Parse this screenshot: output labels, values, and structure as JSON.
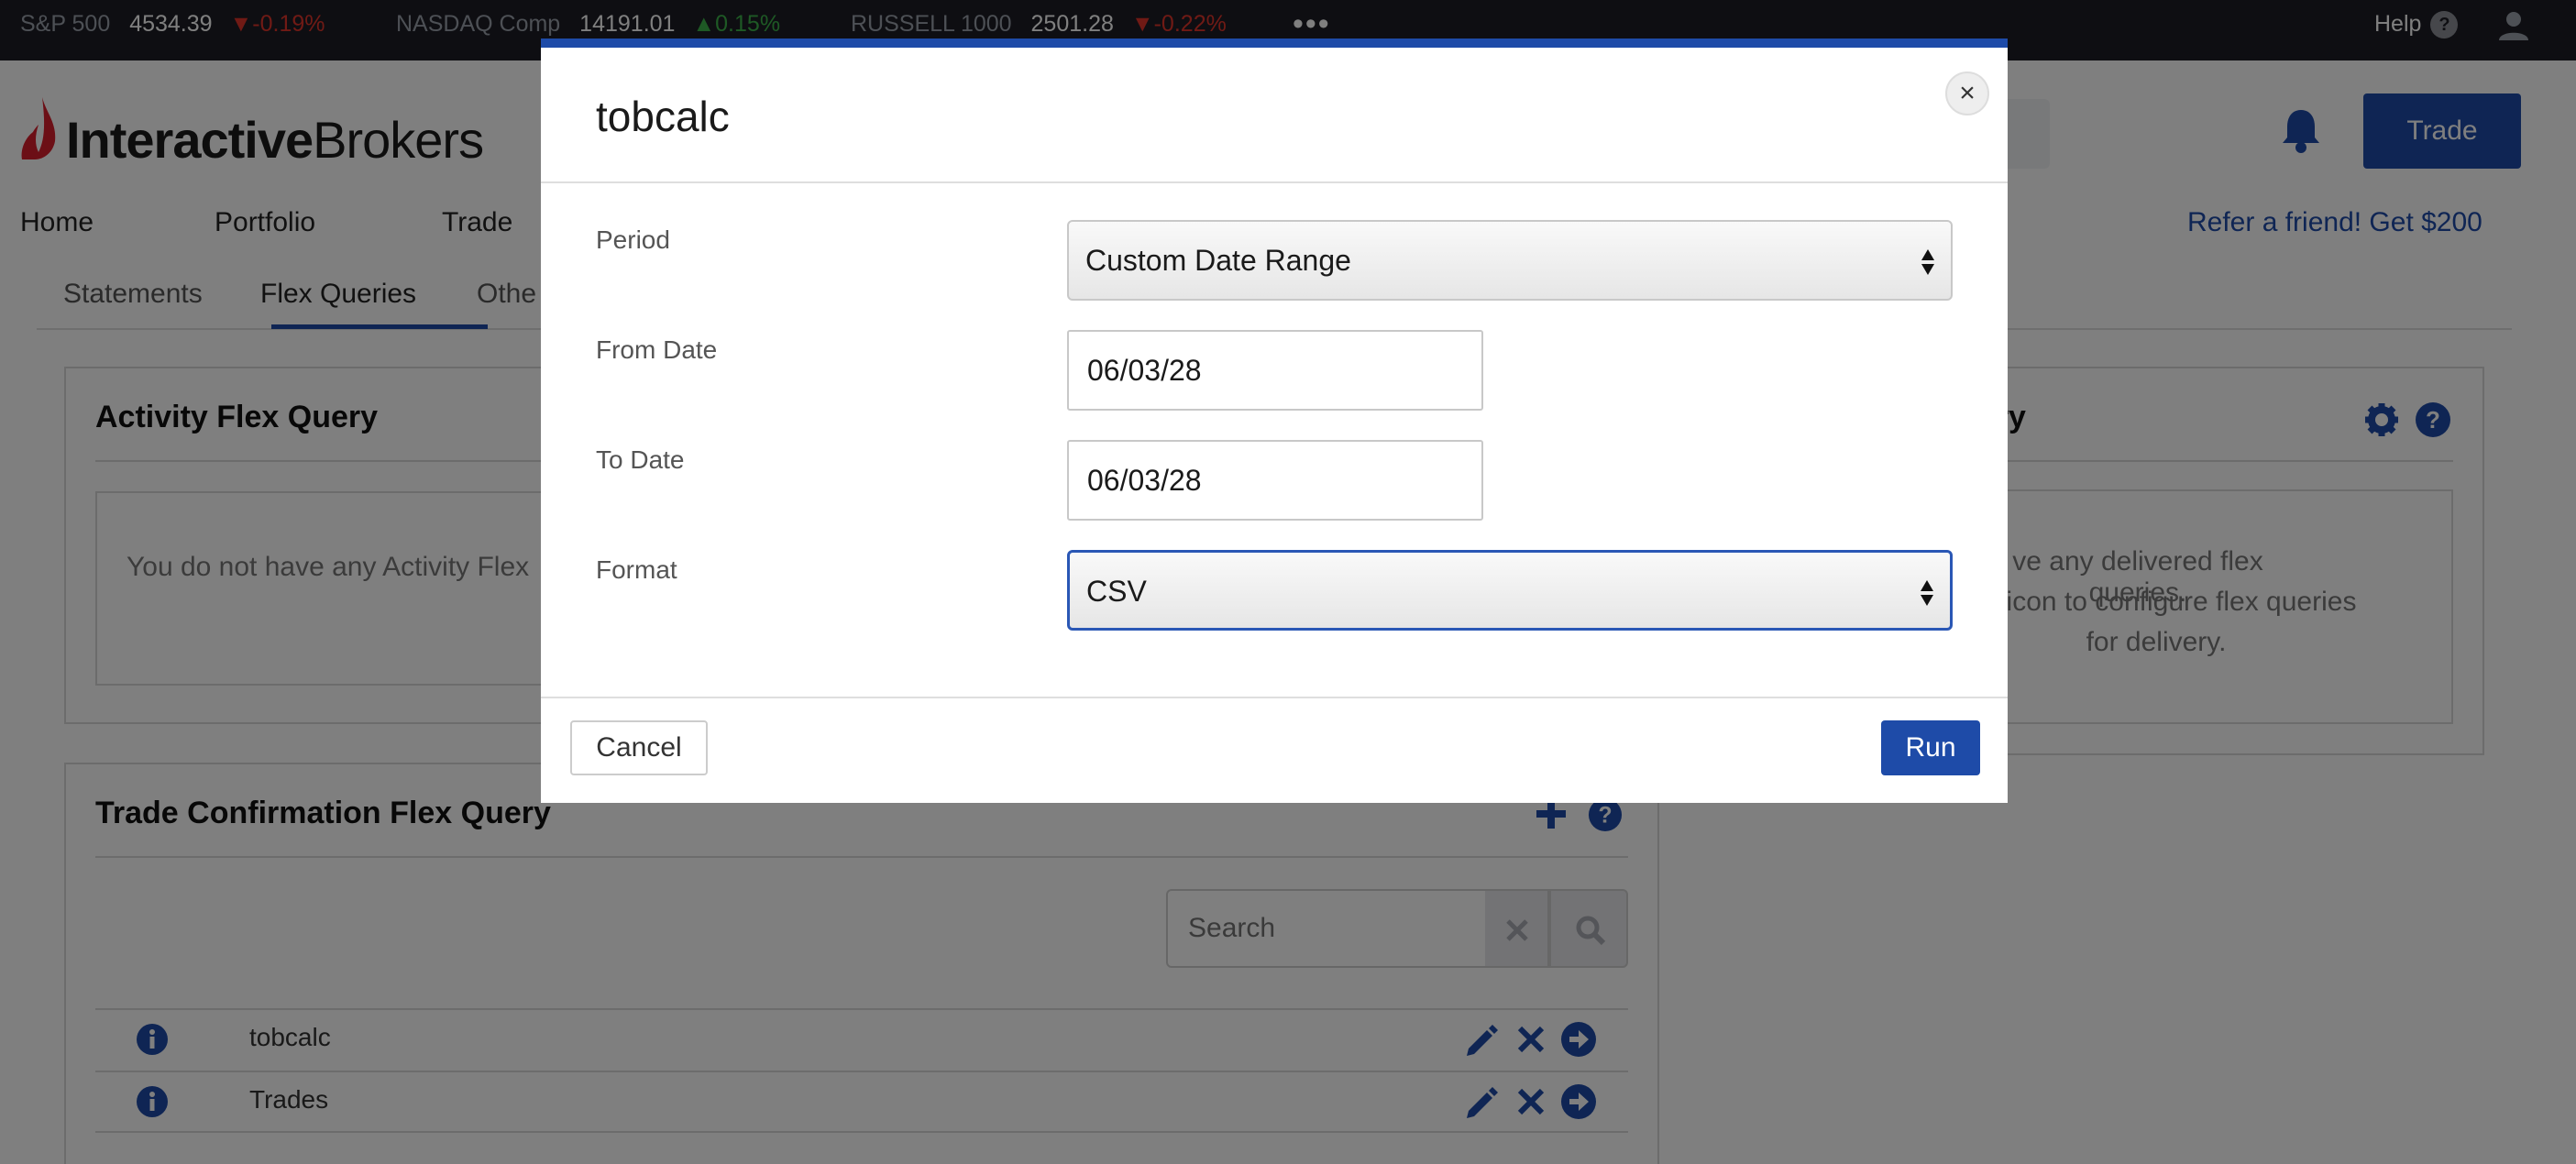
{
  "ticker": {
    "items": [
      {
        "symbol": "S&P 500",
        "value": "4534.39",
        "change": "-0.19%",
        "direction": "down"
      },
      {
        "symbol": "NASDAQ Comp",
        "value": "14191.01",
        "change": "0.15%",
        "direction": "up"
      },
      {
        "symbol": "RUSSELL 1000",
        "value": "2501.28",
        "change": "-0.22%",
        "direction": "down"
      }
    ],
    "more": "•••",
    "help_label": "Help",
    "help_glyph": "?"
  },
  "header": {
    "logo_bold": "Interactive",
    "logo_light": "Brokers",
    "trade_button": "Trade",
    "nav": [
      "Home",
      "Portfolio",
      "Trade"
    ],
    "refer": "Refer a friend! Get $200"
  },
  "subtabs": [
    "Statements",
    "Flex Queries",
    "Othe"
  ],
  "activity_panel": {
    "title": "Activity Flex Query",
    "empty_text": "You do not have any Activity Flex"
  },
  "delivery_panel": {
    "title_fragment": "very",
    "empty_lines": [
      "ve any delivered flex queries.",
      "re icon to configure flex queries",
      "for delivery."
    ]
  },
  "trade_panel": {
    "title": "Trade Confirmation Flex Query",
    "search_placeholder": "Search",
    "rows": [
      {
        "name": "tobcalc"
      },
      {
        "name": "Trades"
      }
    ]
  },
  "modal": {
    "title": "tobcalc",
    "close_glyph": "×",
    "fields": {
      "period_label": "Period",
      "period_value": "Custom Date Range",
      "from_label": "From Date",
      "from_value": "06/03/28",
      "to_label": "To Date",
      "to_value": "06/03/28",
      "format_label": "Format",
      "format_value": "CSV"
    },
    "cancel": "Cancel",
    "run": "Run"
  },
  "colors": {
    "brand_blue": "#1e4ba8",
    "ticker_bg": "#1c1d24",
    "down": "#e0352b",
    "up": "#3db34a",
    "logo_red": "#d81e2c"
  }
}
